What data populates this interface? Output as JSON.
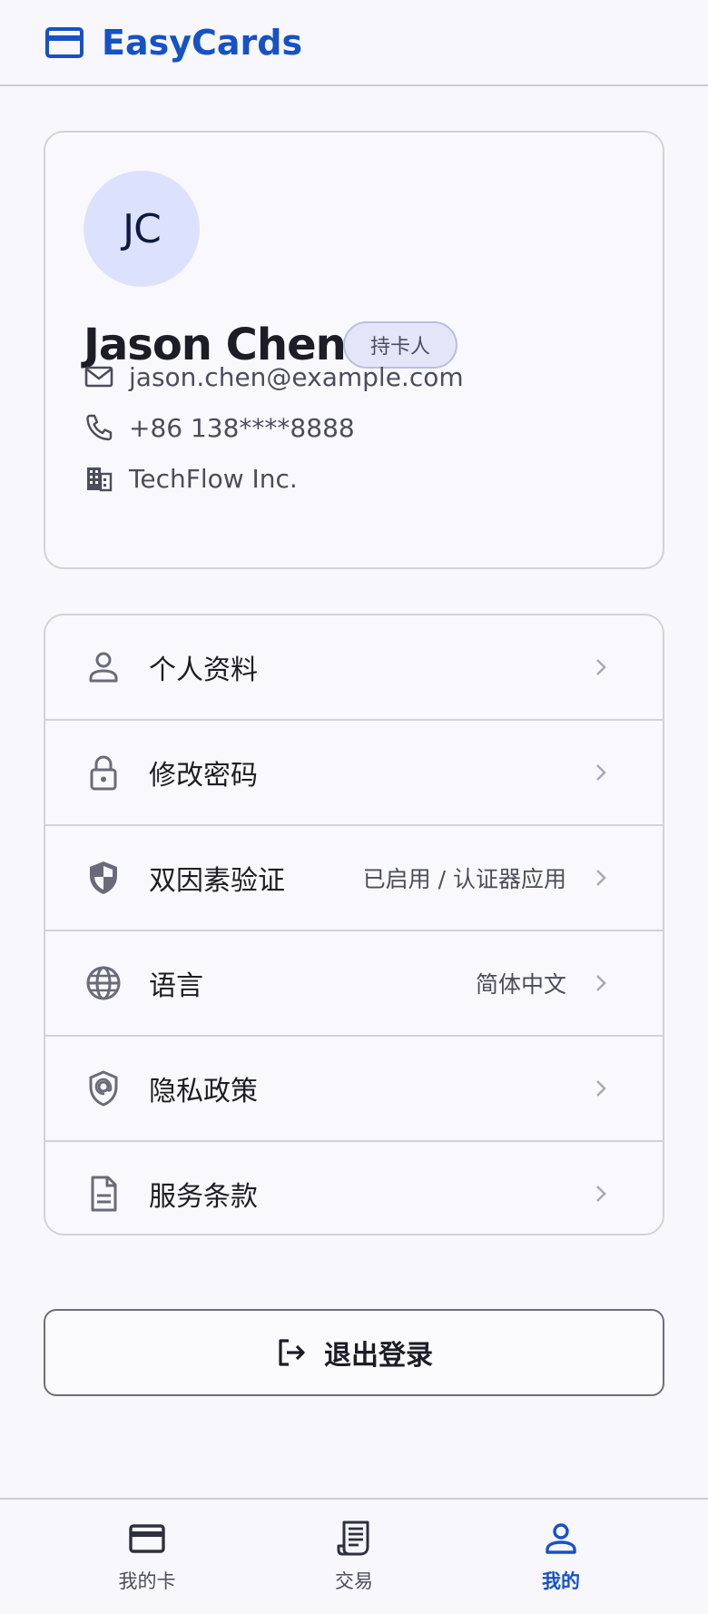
{
  "header": {
    "brand_name": "EasyCards",
    "brand_icon": "credit-card-icon",
    "brand_color": "#1652c4"
  },
  "profile": {
    "initials": "JC",
    "name": "Jason Chen",
    "role": "持卡人",
    "email": "jason.chen@example.com",
    "phone": "+86 138****8888",
    "company": "TechFlow Inc."
  },
  "menu": {
    "items": [
      {
        "label": "个人资料",
        "value": "",
        "icon": "user-icon"
      },
      {
        "label": "修改密码",
        "value": "",
        "icon": "lock-icon"
      },
      {
        "label": "双因素验证",
        "value": "已启用 / 认证器应用",
        "icon": "shield-icon"
      },
      {
        "label": "语言",
        "value": "简体中文",
        "icon": "globe-icon"
      },
      {
        "label": "隐私政策",
        "value": "",
        "icon": "privacy-shield-icon"
      },
      {
        "label": "服务条款",
        "value": "",
        "icon": "document-icon"
      }
    ]
  },
  "logout": {
    "label": "退出登录"
  },
  "nav": {
    "items": [
      {
        "label": "我的卡",
        "icon": "card-icon",
        "active": false
      },
      {
        "label": "交易",
        "icon": "receipt-icon",
        "active": false
      },
      {
        "label": "我的",
        "icon": "person-icon",
        "active": true
      }
    ],
    "active_color": "#1652c4"
  }
}
